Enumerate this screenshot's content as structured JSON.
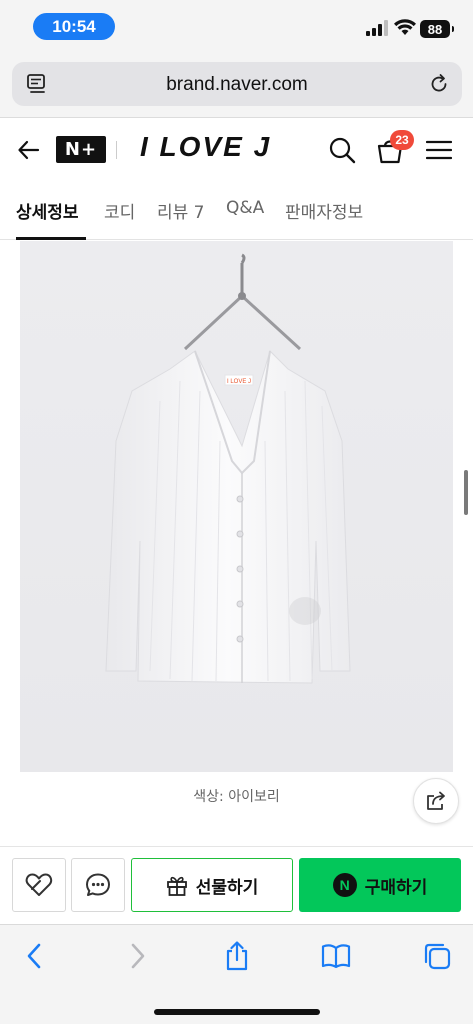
{
  "status_bar": {
    "time": "10:54",
    "battery": "88"
  },
  "browser": {
    "url": "brand.naver.com"
  },
  "header": {
    "nplus_logo": "N+",
    "brand_title": "I LOVE J",
    "cart_count": "23"
  },
  "tabs": [
    {
      "label": "상세정보",
      "active": true
    },
    {
      "label": "코디",
      "active": false
    },
    {
      "label": "리뷰 7",
      "active": false
    },
    {
      "label": "Q&A",
      "active": false
    },
    {
      "label": "판매자정보",
      "active": false
    }
  ],
  "product": {
    "tag_text": "I LOVE J",
    "caption": "색상: 아이보리"
  },
  "actions": {
    "gift_label": "선물하기",
    "buy_label": "구매하기",
    "naver_mark": "N"
  },
  "colors": {
    "naver_green": "#03c75a",
    "badge_red": "#f04a3a",
    "time_pill_blue": "#1a7cf5",
    "safari_blue": "#1a7cf5"
  },
  "icons": [
    "reader-icon",
    "reload-icon",
    "back-arrow-icon",
    "search-icon",
    "cart-icon",
    "menu-icon",
    "share-icon",
    "heart-icon",
    "chat-icon",
    "gift-icon",
    "safari-back-icon",
    "safari-forward-icon",
    "safari-share-icon",
    "bookmarks-icon",
    "tabs-icon"
  ]
}
